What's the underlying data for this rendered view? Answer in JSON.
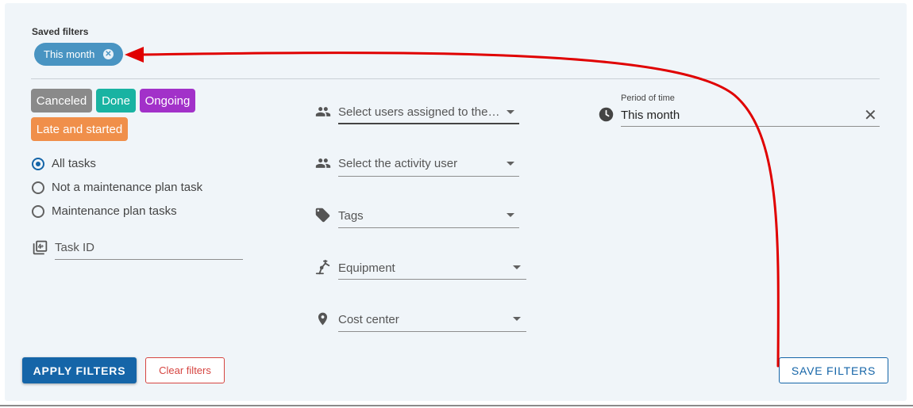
{
  "saved_filters": {
    "label": "Saved filters",
    "chip_label": "This month",
    "chip_remove_icon": "close-circle-icon"
  },
  "status_chips": [
    {
      "label": "Canceled",
      "color": "#8a8a8a"
    },
    {
      "label": "Done",
      "color": "#19b3a2"
    },
    {
      "label": "Ongoing",
      "color": "#a231c9"
    },
    {
      "label": "Late and started",
      "color": "#f08f4a"
    }
  ],
  "task_type": {
    "options": [
      "All tasks",
      "Not a maintenance plan task",
      "Maintenance plan tasks"
    ],
    "selected": "All tasks"
  },
  "task_id": {
    "placeholder": "Task ID",
    "icon": "task-id-icon"
  },
  "selects": {
    "assigned_users": {
      "placeholder": "Select users assigned to the…",
      "icon": "people-icon"
    },
    "activity_user": {
      "placeholder": "Select the activity user",
      "icon": "people-icon"
    },
    "tags": {
      "placeholder": "Tags",
      "icon": "tag-icon"
    },
    "equipment": {
      "placeholder": "Equipment",
      "icon": "equipment-icon"
    },
    "cost_center": {
      "placeholder": "Cost center",
      "icon": "location-pin-icon"
    }
  },
  "period": {
    "label": "Period of time",
    "value": "This month",
    "icon": "clock-icon",
    "clear_icon": "close-icon"
  },
  "buttons": {
    "apply": "APPLY FILTERS",
    "clear": "Clear filters",
    "save": "SAVE FILTERS"
  },
  "annotation": {
    "arrow_color": "#e00000"
  },
  "colors": {
    "primary": "#1565a8",
    "panel_bg": "#f0f5f9",
    "danger": "#d64541"
  }
}
